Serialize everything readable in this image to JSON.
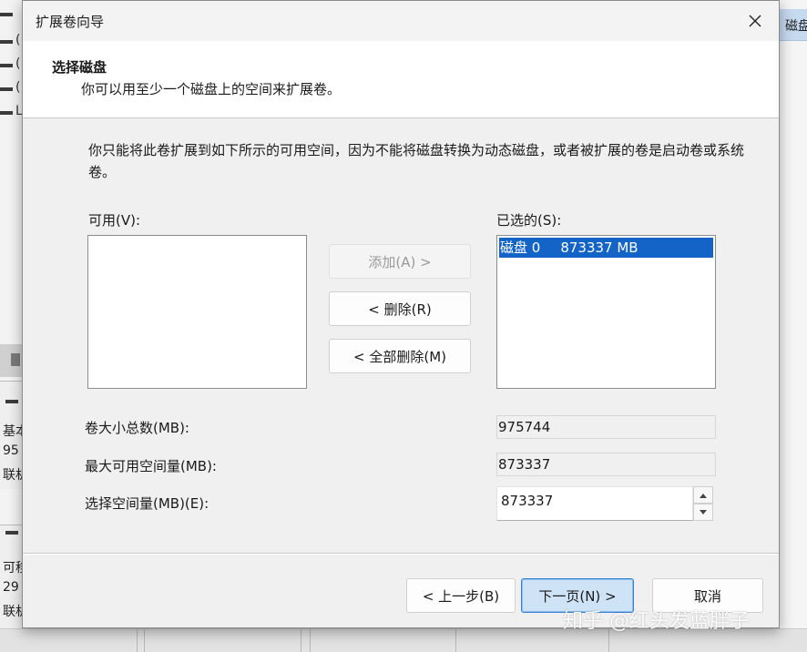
{
  "background": {
    "volume_rows": [
      "(",
      "(",
      "(",
      "L"
    ],
    "disk1": [
      "基本",
      "95",
      "联机"
    ],
    "disk2": [
      "可移",
      "29",
      "联机"
    ],
    "right_header": "磁盘"
  },
  "dialog": {
    "title": "扩展卷向导",
    "header_title": "选择磁盘",
    "header_subtitle": "你可以用至少一个磁盘上的空间来扩展卷。",
    "description": "你只能将此卷扩展到如下所示的可用空间，因为不能将磁盘转换为动态磁盘，或者被扩展的卷是启动卷或系统卷。",
    "available_label": "可用(V):",
    "selected_label": "已选的(S):",
    "selected_items": [
      {
        "disk": "磁盘 0",
        "size": "873337 MB"
      }
    ],
    "buttons": {
      "add": "添加(A) >",
      "remove": "< 删除(R)",
      "remove_all": "< 全部删除(M)",
      "back": "< 上一步(B)",
      "next": "下一页(N) >",
      "cancel": "取消"
    },
    "fields": {
      "total_label": "卷大小总数(MB):",
      "total_value": "975744",
      "max_label": "最大可用空间量(MB):",
      "max_value": "873337",
      "select_label": "选择空间量(MB)(E):",
      "select_value": "873337"
    }
  },
  "watermark": "知乎 @红头发蓝胖子",
  "colors": {
    "selection": "#1464c8",
    "primary_button_border": "#3a83d4",
    "primary_button_fill": "#cfe3f7"
  }
}
